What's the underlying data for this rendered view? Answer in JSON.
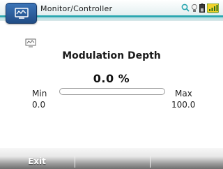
{
  "window": {
    "title": "Monitor/Controller",
    "accent_color": "#2aa7b0",
    "icon": "monitor-controller-icon"
  },
  "status_bar": {
    "icons": [
      "search-icon",
      "bulb-icon",
      "battery-icon",
      "signal-icon"
    ]
  },
  "main": {
    "heading": "Modulation Depth",
    "value_display": "0.0 %",
    "value_fraction": 0.0,
    "min_label": "Min",
    "min_value": "0.0",
    "max_label": "Max",
    "max_value": "100.0"
  },
  "softkeys": {
    "left_label": "Exit",
    "middle_label": "",
    "right_label": ""
  }
}
